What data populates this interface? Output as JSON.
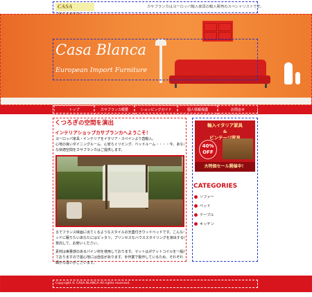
{
  "site": {
    "logo_text": "CASA BLANCA",
    "tagline": "カサブランカはヨーロッパ輸入家具の輸入販売のスペシャリストです。"
  },
  "hero": {
    "title": "Casa Blanca",
    "subtitle": "European Import Furniture"
  },
  "nav": {
    "items": [
      {
        "label": "トップ"
      },
      {
        "label": "カサブランカ概要"
      },
      {
        "label": "ショッピングガイド"
      },
      {
        "label": "個人情報保護"
      },
      {
        "label": "お問合せ"
      }
    ]
  },
  "main": {
    "heading": "くつろぎの空間を演出",
    "subheading": "インテリアショップカサブランカへようこそ！",
    "intro_lines": [
      "ヨーロッパ家具・インテリアをイタリア・スペインより直輸入。",
      "心地の良いダイニングルーム、心安らぐリビング、ベッドルーム・・・・今、あなた",
      "な快適空間をカサブランカはご提供します。"
    ],
    "desc_lines": [
      "るでフランス映画に出てくるようなスタイルの天蓋付きウッドベッドです。こんなべ",
      "ッドに眠りたいあなたにはピッタリ。プリンセスなハウススタイリングを演出する何",
      "意向して、お使いください。",
      "",
      "素材は実量感のあるパイン材を使用しております。マットはポケットコイルを一般用",
      "ておりますので寝心地には自信があります。手作業で製作しているため、それぞれ",
      "細かな違いがございます。"
    ]
  },
  "sidebar": {
    "banner": {
      "line1": "輸入イタリア家具",
      "line2": "&",
      "line3": "ビンテージ家具",
      "badge_percent": "40%",
      "badge_off": "OFF",
      "sale_text": "大特価セール開催中！"
    },
    "categories_title": "CATEGORIES",
    "categories": [
      {
        "label": "ソファー"
      },
      {
        "label": "ベッド"
      },
      {
        "label": "テーブル"
      },
      {
        "label": "キッチン"
      }
    ]
  },
  "footer": {
    "copyright": "Copyright © CASA BLANCA All rights reserved."
  },
  "colors": {
    "accent_red": "#d8141c",
    "hero_orange": "#f07c30",
    "heading_red": "#d0121a"
  }
}
